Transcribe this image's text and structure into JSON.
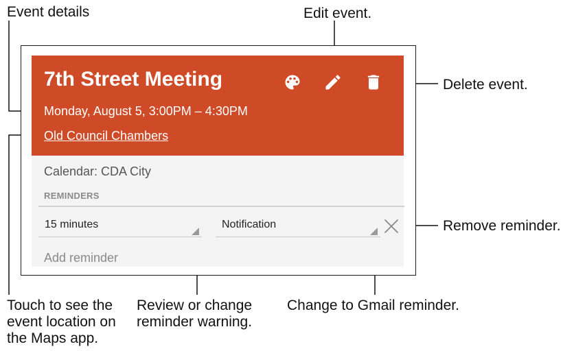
{
  "callouts": {
    "event_details": "Event details",
    "edit_event": "Edit event.",
    "delete_event": "Delete event.",
    "remove_reminder": "Remove reminder.",
    "touch_location": "Touch to see the event location on the Maps app.",
    "review_reminder": "Review or change reminder warning.",
    "change_gmail": "Change to Gmail reminder."
  },
  "event": {
    "title": "7th Street Meeting",
    "datetime": "Monday, August 5, 3:00PM – 4:30PM",
    "location": "Old Council Chambers",
    "calendar": "Calendar: CDA City"
  },
  "reminders": {
    "header": "REMINDERS",
    "items": [
      {
        "time": "15 minutes",
        "method": "Notification"
      }
    ],
    "add_label": "Add reminder"
  },
  "icons": {
    "color": "palette-icon",
    "edit": "pencil-icon",
    "delete": "trash-icon",
    "remove": "close-icon"
  },
  "colors": {
    "header_bg": "#cf4a26",
    "card_bg": "#f4f4f4"
  }
}
